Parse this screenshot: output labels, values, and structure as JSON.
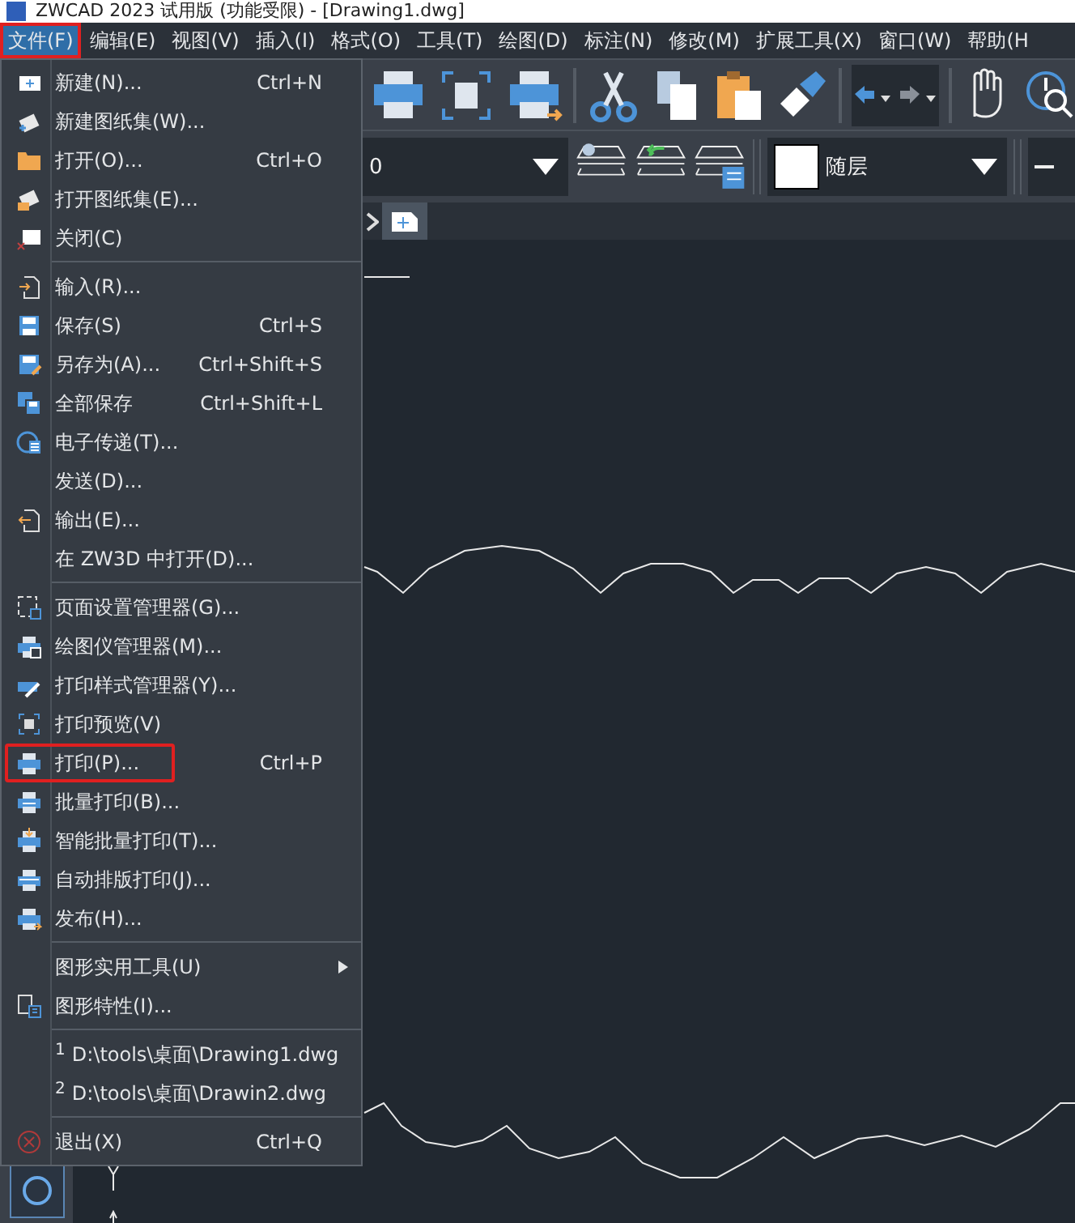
{
  "window": {
    "title": "ZWCAD 2023 试用版 (功能受限) - [Drawing1.dwg]"
  },
  "menubar": [
    {
      "label": "文件(F)",
      "selected": true,
      "highlighted": true
    },
    {
      "label": "编辑(E)",
      "selected": false,
      "highlighted": false
    },
    {
      "label": "视图(V)",
      "selected": false,
      "highlighted": false
    },
    {
      "label": "插入(I)",
      "selected": false,
      "highlighted": false
    },
    {
      "label": "格式(O)",
      "selected": false,
      "highlighted": false
    },
    {
      "label": "工具(T)",
      "selected": false,
      "highlighted": false
    },
    {
      "label": "绘图(D)",
      "selected": false,
      "highlighted": false
    },
    {
      "label": "标注(N)",
      "selected": false,
      "highlighted": false
    },
    {
      "label": "修改(M)",
      "selected": false,
      "highlighted": false
    },
    {
      "label": "扩展工具(X)",
      "selected": false,
      "highlighted": false
    },
    {
      "label": "窗口(W)",
      "selected": false,
      "highlighted": false
    },
    {
      "label": "帮助(H",
      "selected": false,
      "highlighted": false
    }
  ],
  "file_menu": [
    {
      "kind": "item",
      "label": "新建(N)...",
      "shortcut": "Ctrl+N",
      "highlighted": false
    },
    {
      "kind": "item",
      "label": "新建图纸集(W)...",
      "highlighted": false
    },
    {
      "kind": "item",
      "label": "打开(O)...",
      "shortcut": "Ctrl+O",
      "highlighted": false
    },
    {
      "kind": "item",
      "label": "打开图纸集(E)...",
      "highlighted": false
    },
    {
      "kind": "item",
      "label": "关闭(C)",
      "highlighted": false
    },
    {
      "kind": "separator"
    },
    {
      "kind": "item",
      "label": "输入(R)...",
      "highlighted": false
    },
    {
      "kind": "item",
      "label": "保存(S)",
      "shortcut": "Ctrl+S",
      "highlighted": false
    },
    {
      "kind": "item",
      "label": "另存为(A)...",
      "shortcut": "Ctrl+Shift+S",
      "highlighted": false
    },
    {
      "kind": "item",
      "label": "全部保存",
      "shortcut": "Ctrl+Shift+L",
      "highlighted": false
    },
    {
      "kind": "item",
      "label": "电子传递(T)...",
      "highlighted": false
    },
    {
      "kind": "item",
      "label": "发送(D)...",
      "highlighted": false
    },
    {
      "kind": "item",
      "label": "输出(E)...",
      "highlighted": false
    },
    {
      "kind": "item",
      "label": "在 ZW3D 中打开(D)...",
      "highlighted": false
    },
    {
      "kind": "separator"
    },
    {
      "kind": "item",
      "label": "页面设置管理器(G)...",
      "highlighted": false
    },
    {
      "kind": "item",
      "label": "绘图仪管理器(M)...",
      "highlighted": false
    },
    {
      "kind": "item",
      "label": "打印样式管理器(Y)...",
      "highlighted": false
    },
    {
      "kind": "item",
      "label": "打印预览(V)",
      "highlighted": false
    },
    {
      "kind": "item",
      "label": "打印(P)...",
      "shortcut": "Ctrl+P",
      "highlighted": true
    },
    {
      "kind": "item",
      "label": "批量打印(B)...",
      "highlighted": false
    },
    {
      "kind": "item",
      "label": "智能批量打印(T)...",
      "highlighted": false
    },
    {
      "kind": "item",
      "label": "自动排版打印(J)...",
      "highlighted": false
    },
    {
      "kind": "item",
      "label": "发布(H)...",
      "highlighted": false
    },
    {
      "kind": "separator"
    },
    {
      "kind": "submenu",
      "label": "图形实用工具(U)",
      "highlighted": false
    },
    {
      "kind": "item",
      "label": "图形特性(I)...",
      "highlighted": false
    },
    {
      "kind": "separator"
    },
    {
      "kind": "recent",
      "number": "1",
      "label": "D:\\tools\\桌面\\Drawing1.dwg",
      "highlighted": false
    },
    {
      "kind": "recent",
      "number": "2",
      "label": "D:\\tools\\桌面\\Drawin2.dwg",
      "highlighted": false
    },
    {
      "kind": "separator"
    },
    {
      "kind": "item",
      "label": "退出(X)",
      "shortcut": "Ctrl+Q",
      "highlighted": false
    }
  ],
  "properties_toolbar": {
    "layer_value": "0",
    "color_value": "随层"
  }
}
